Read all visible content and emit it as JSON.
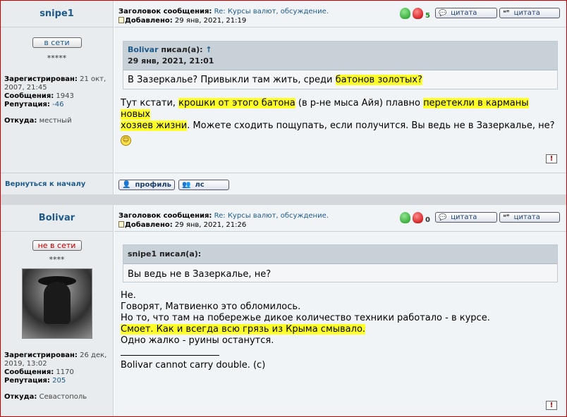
{
  "posts": [
    {
      "username": "snipe1",
      "status": "в сети",
      "stars": "*****",
      "registered_label": "Зарегистрирован:",
      "registered_value": "21 окт, 2007, 21:45",
      "messages_label": "Сообщения:",
      "messages_value": "1943",
      "reputation_label": "Репутация:",
      "reputation_value": "-46",
      "from_label": "Откуда:",
      "from_value": "местный",
      "subject_label": "Заголовок сообщения:",
      "subject_value": "Re: Курсы валют, обсуждение.",
      "added_label": "Добавлено:",
      "added_value": "29 янв, 2021, 21:19",
      "score": "5",
      "quote_btn1": "цитата",
      "quote_btn2": "цитата",
      "quote": {
        "author": "Bolivar",
        "wrote": "писал(а):",
        "arrow": "↑",
        "date": "29 янв, 2021, 21:01",
        "text_before": "В Зазеркалье? Привыкли там жить, среди ",
        "text_hl": "батонов золотых?"
      },
      "body": {
        "p1": "Тут кстати, ",
        "p1_hl1": "крошки от этого батона",
        "p1_mid": " (в р-не мыса Айя) плавно ",
        "p1_hl2": "перетекли в карманы новых",
        "p2_hl": "хозяев жизни",
        "p2_rest": ". Можете сходить пощупать, если получится. Вы ведь не в Зазеркалье, не?",
        "smile": "☺"
      },
      "report": "!",
      "back_to_top": "Вернуться к началу",
      "profile_btn": "профиль",
      "pm_btn": "лс"
    },
    {
      "username": "Bolivar",
      "status": "не в сети",
      "stars": "****",
      "registered_label": "Зарегистрирован:",
      "registered_value": "26 дек, 2019, 13:02",
      "messages_label": "Сообщения:",
      "messages_value": "1170",
      "reputation_label": "Репутация:",
      "reputation_value": "205",
      "from_label": "Откуда:",
      "from_value": "Севастополь",
      "subject_label": "Заголовок сообщения:",
      "subject_value": "Re: Курсы валют, обсуждение.",
      "added_label": "Добавлено:",
      "added_value": "29 янв, 2021, 21:26",
      "score": "0",
      "quote_btn1": "цитата",
      "quote_btn2": "цитата",
      "quote": {
        "author": "snipe1",
        "wrote": "писал(а):",
        "text": "Вы ведь не в Зазеркалье, не?"
      },
      "body": {
        "l1": "Не.",
        "l2": "Говорят, Матвиенко это обломилось.",
        "l3": "Но то, что там на побережье дикое количество техники работало - в курсе.",
        "l4_hl": "Смоет. Как и всегда всю грязь из Крыма смывало.",
        "l5": "Одно жалко - руины останутся.",
        "signature": "Bolivar cannot carry double. (c)"
      },
      "report": "!"
    }
  ],
  "colors": {
    "highlight": "#ffff2a",
    "link": "#1d5a8a",
    "panel": "#e8ecef"
  }
}
